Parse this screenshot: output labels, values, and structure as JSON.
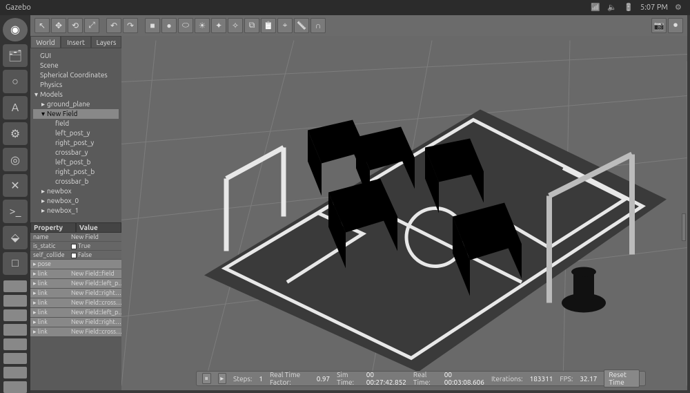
{
  "menubar": {
    "title": "Gazebo",
    "time": "5:07 PM"
  },
  "launcher": {
    "items": [
      {
        "name": "ubuntu-icon",
        "glyph": "◉"
      },
      {
        "name": "files-icon",
        "glyph": "🗂"
      },
      {
        "name": "firefox-icon",
        "glyph": "○"
      },
      {
        "name": "updates-icon",
        "glyph": "A"
      },
      {
        "name": "settings-icon",
        "glyph": "⚙"
      },
      {
        "name": "gazebo-icon",
        "glyph": "◎"
      },
      {
        "name": "vscode-icon",
        "glyph": "✕"
      },
      {
        "name": "terminal-icon",
        "glyph": ">_"
      },
      {
        "name": "app-icon",
        "glyph": "⬙"
      },
      {
        "name": "app2-icon",
        "glyph": "□"
      }
    ]
  },
  "toolbar": {
    "left": [
      {
        "name": "select-icon",
        "glyph": "↖"
      },
      {
        "name": "move-icon",
        "glyph": "✥"
      },
      {
        "name": "rotate-icon",
        "glyph": "⟲"
      },
      {
        "name": "scale-icon",
        "glyph": "⤢"
      },
      {
        "name": "undo-icon",
        "glyph": "↶"
      },
      {
        "name": "redo-icon",
        "glyph": "↷"
      }
    ],
    "mid": [
      {
        "name": "box-icon",
        "glyph": "■"
      },
      {
        "name": "sphere-icon",
        "glyph": "●"
      },
      {
        "name": "cylinder-icon",
        "glyph": "⬭"
      },
      {
        "name": "light-point-icon",
        "glyph": "☀"
      },
      {
        "name": "light-dir-icon",
        "glyph": "✦"
      },
      {
        "name": "light-spot-icon",
        "glyph": "✧"
      },
      {
        "name": "copy-icon",
        "glyph": "⧉"
      },
      {
        "name": "paste-icon",
        "glyph": "📋"
      },
      {
        "name": "snap-icon",
        "glyph": "⌖"
      },
      {
        "name": "measure-icon",
        "glyph": "📏"
      },
      {
        "name": "joint-icon",
        "glyph": "∩"
      }
    ],
    "right": [
      {
        "name": "camera-icon",
        "glyph": "📷"
      },
      {
        "name": "record-icon",
        "glyph": "⏺"
      }
    ]
  },
  "panel": {
    "tabs": [
      "World",
      "Insert",
      "Layers"
    ],
    "active_tab": 0,
    "tree": [
      {
        "lv": 0,
        "label": "GUI",
        "arrow": ""
      },
      {
        "lv": 0,
        "label": "Scene",
        "arrow": ""
      },
      {
        "lv": 0,
        "label": "Spherical Coordinates",
        "arrow": ""
      },
      {
        "lv": 0,
        "label": "Physics",
        "arrow": ""
      },
      {
        "lv": 0,
        "label": "Models",
        "arrow": "▾"
      },
      {
        "lv": 1,
        "label": "ground_plane",
        "arrow": "▸"
      },
      {
        "lv": 1,
        "label": "New Field",
        "arrow": "▾",
        "sel": true
      },
      {
        "lv": 2,
        "label": "field",
        "arrow": ""
      },
      {
        "lv": 2,
        "label": "left_post_y",
        "arrow": ""
      },
      {
        "lv": 2,
        "label": "right_post_y",
        "arrow": ""
      },
      {
        "lv": 2,
        "label": "crossbar_y",
        "arrow": ""
      },
      {
        "lv": 2,
        "label": "left_post_b",
        "arrow": ""
      },
      {
        "lv": 2,
        "label": "right_post_b",
        "arrow": ""
      },
      {
        "lv": 2,
        "label": "crossbar_b",
        "arrow": ""
      },
      {
        "lv": 1,
        "label": "newbox",
        "arrow": "▸"
      },
      {
        "lv": 1,
        "label": "newbox_0",
        "arrow": "▸"
      },
      {
        "lv": 1,
        "label": "newbox_1",
        "arrow": "▸"
      }
    ],
    "prop_header": {
      "c0": "Property",
      "c1": "Value"
    },
    "props": [
      {
        "k": "name",
        "v": "New Field",
        "chk": false
      },
      {
        "k": "is_static",
        "v": "True",
        "chk": true
      },
      {
        "k": "self_collide",
        "v": "False",
        "chk": true
      },
      {
        "k": "▸ pose",
        "v": "",
        "alt": true
      },
      {
        "k": "▸ link",
        "v": "New Field::field",
        "alt": true
      },
      {
        "k": "▸ link",
        "v": "New Field::left_p…",
        "alt": true
      },
      {
        "k": "▸ link",
        "v": "New Field::right…",
        "alt": true
      },
      {
        "k": "▸ link",
        "v": "New Field::cross…",
        "alt": true
      },
      {
        "k": "▸ link",
        "v": "New Field::left_p…",
        "alt": true
      },
      {
        "k": "▸ link",
        "v": "New Field::right…",
        "alt": true
      },
      {
        "k": "▸ link",
        "v": "New Field::cross…",
        "alt": true
      }
    ]
  },
  "status": {
    "steps_label": "Steps:",
    "steps": "1",
    "rtf_label": "Real Time Factor:",
    "rtf": "0.97",
    "sim_label": "Sim Time:",
    "sim": "00 00:27:42.852",
    "real_label": "Real Time:",
    "real": "00 00:03:08.606",
    "iter_label": "Iterations:",
    "iter": "183311",
    "fps_label": "FPS:",
    "fps": "32.17",
    "reset": "Reset Time"
  }
}
